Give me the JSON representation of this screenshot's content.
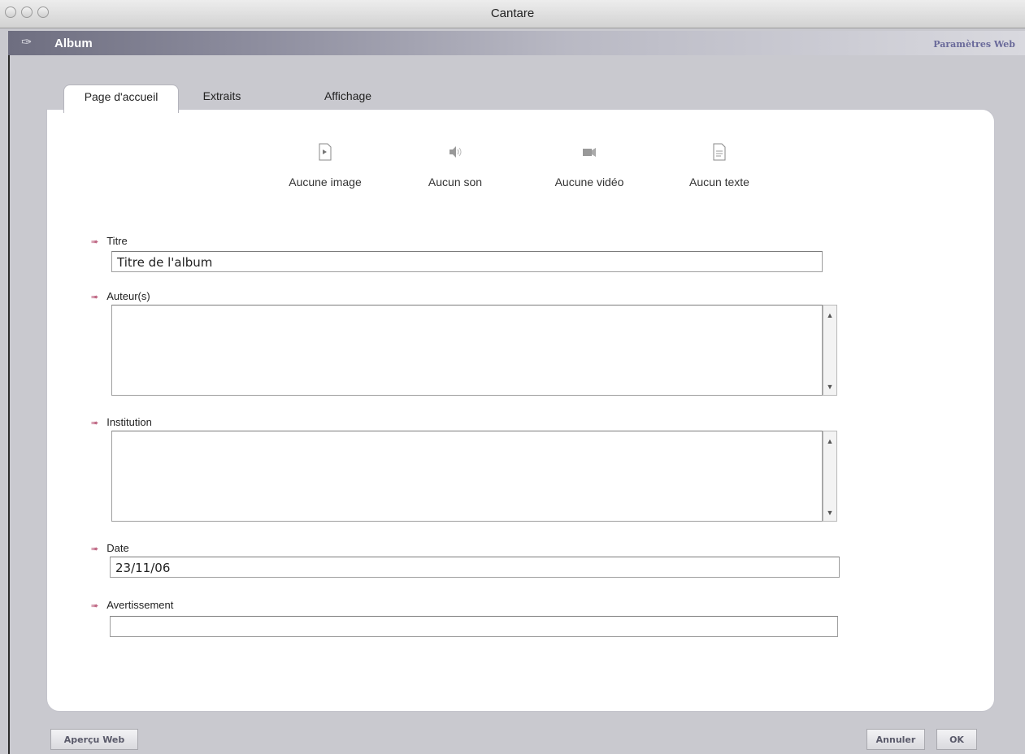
{
  "window": {
    "title": "Cantare"
  },
  "header": {
    "section_title": "Album",
    "web_params_label": "Paramètres Web"
  },
  "tabs": [
    {
      "label": "Page d'accueil",
      "active": true
    },
    {
      "label": "Extraits",
      "active": false
    },
    {
      "label": "Affichage",
      "active": false
    }
  ],
  "media": [
    {
      "label": "Aucune image",
      "icon": "image-file-icon"
    },
    {
      "label": "Aucun son",
      "icon": "speaker-icon"
    },
    {
      "label": "Aucune vidéo",
      "icon": "video-camera-icon"
    },
    {
      "label": "Aucun texte",
      "icon": "text-file-icon"
    }
  ],
  "fields": {
    "titre": {
      "label": "Titre",
      "value": "Titre de l'album"
    },
    "auteurs": {
      "label": "Auteur(s)",
      "value": ""
    },
    "institution": {
      "label": "Institution",
      "value": ""
    },
    "date": {
      "label": "Date",
      "value": "23/11/06"
    },
    "avertissement": {
      "label": "Avertissement",
      "value": ""
    }
  },
  "buttons": {
    "preview": "Aperçu Web",
    "cancel": "Annuler",
    "ok": "OK"
  },
  "colors": {
    "label_arrow": "#c06a86",
    "accent_link": "#6a6a9a"
  }
}
